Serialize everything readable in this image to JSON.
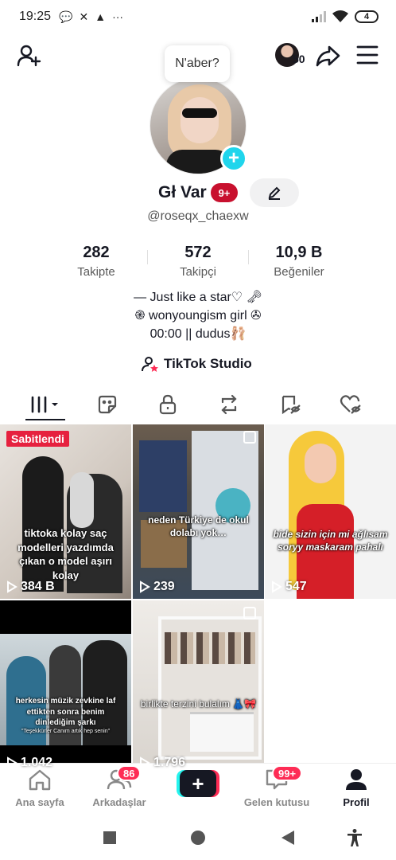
{
  "status_bar": {
    "time": "19:25",
    "battery": "4"
  },
  "header": {
    "friends_count": "50",
    "bubble_text": "N'aber?"
  },
  "profile": {
    "display_name": "Gł Var",
    "badge": "9+",
    "username": "@roseqx_chaexw"
  },
  "stats": [
    {
      "value": "282",
      "label": "Takipte"
    },
    {
      "value": "572",
      "label": "Takipçi"
    },
    {
      "value": "10,9 B",
      "label": "Beğeniler"
    }
  ],
  "bio": [
    "— Just like a star♡ 🗝",
    "֎ wonyoungism girl ✇",
    "00:00 || dudus🩰"
  ],
  "studio_label": "TikTok Studio",
  "tabs": [
    "videos-tab",
    "reposts-sticker-tab",
    "private-tab",
    "reposts-tab",
    "favorites-tab",
    "liked-tab"
  ],
  "videos": [
    {
      "pinned": "Sabitlendi",
      "caption": "tiktoka kolay saç modelleri yazdımda çıkan o model aşırı kolay",
      "views": "384 B"
    },
    {
      "caption": "neden Türkiye de okul dolabı yok…",
      "views": "239"
    },
    {
      "caption": "bide sizin için mi ağlısam soryy maskaram pahalı",
      "views": "547"
    },
    {
      "caption": "herkesin müzik zevkine laf ettikten sonra benim dinlediğim şarkı",
      "subcaption": "\"Teşekkürler Canım artık hep senin\"",
      "views": "1.042"
    },
    {
      "caption": "birlikte terzini bulalım 👗🎀",
      "views": "1.796"
    }
  ],
  "bottom_nav": {
    "home": "Ana sayfa",
    "friends": "Arkadaşlar",
    "friends_badge": "86",
    "create": "+",
    "inbox": "Gelen kutusu",
    "inbox_badge": "99+",
    "profile": "Profil"
  },
  "colors": {
    "accent": "#fe2c55",
    "cyan": "#25f4ee",
    "badge_red": "#c8102e",
    "plus_blue": "#20d5ec"
  }
}
